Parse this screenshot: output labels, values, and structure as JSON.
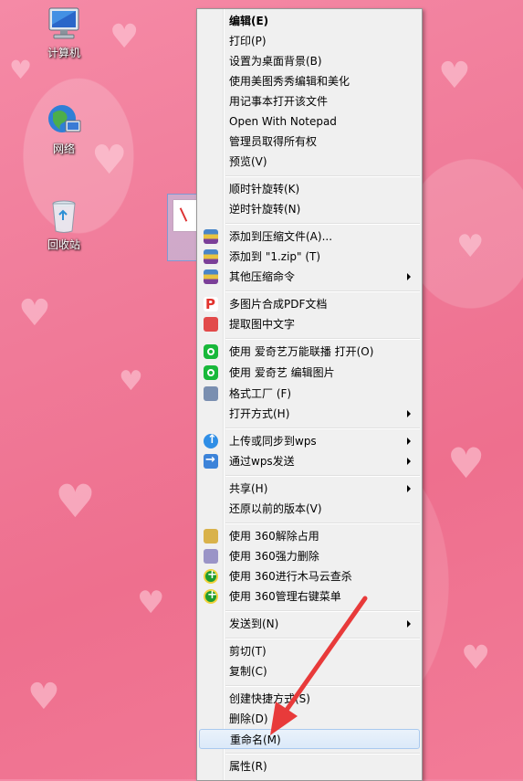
{
  "desktop": {
    "icons": [
      {
        "label": "计算机",
        "icon": "computer-icon"
      },
      {
        "label": "网络",
        "icon": "network-icon"
      },
      {
        "label": "回收站",
        "icon": "recycle-bin-icon"
      }
    ]
  },
  "context_menu": {
    "items": [
      {
        "label": "编辑(E)",
        "bold": true
      },
      {
        "label": "打印(P)"
      },
      {
        "label": "设置为桌面背景(B)"
      },
      {
        "label": "使用美图秀秀编辑和美化"
      },
      {
        "label": "用记事本打开该文件"
      },
      {
        "label": "Open With Notepad"
      },
      {
        "label": "管理员取得所有权"
      },
      {
        "label": "预览(V)"
      },
      {
        "label": "顺时针旋转(K)"
      },
      {
        "label": "逆时针旋转(N)"
      },
      {
        "label": "添加到压缩文件(A)...",
        "icon": "winrar-icon"
      },
      {
        "label": "添加到 \"1.zip\" (T)",
        "icon": "winrar-icon"
      },
      {
        "label": "其他压缩命令",
        "icon": "winrar-icon",
        "submenu": true
      },
      {
        "label": "多图片合成PDF文档",
        "icon": "pdf-icon"
      },
      {
        "label": "提取图中文字",
        "icon": "extract-text-icon"
      },
      {
        "label": "使用 爱奇艺万能联播 打开(O)",
        "icon": "iqiyi-icon"
      },
      {
        "label": "使用 爱奇艺 编辑图片",
        "icon": "iqiyi-icon"
      },
      {
        "label": "格式工厂 (F)",
        "icon": "format-factory-icon"
      },
      {
        "label": "打开方式(H)",
        "submenu": true
      },
      {
        "label": "上传或同步到wps",
        "icon": "cloud-upload-icon",
        "submenu": true
      },
      {
        "label": "通过wps发送",
        "icon": "send-icon",
        "submenu": true
      },
      {
        "label": "共享(H)",
        "submenu": true
      },
      {
        "label": "还原以前的版本(V)"
      },
      {
        "label": "使用 360解除占用",
        "icon": "unlock-icon"
      },
      {
        "label": "使用 360强力删除",
        "icon": "shredder-icon"
      },
      {
        "label": "使用 360进行木马云查杀",
        "icon": "360-icon"
      },
      {
        "label": "使用 360管理右键菜单",
        "icon": "360-icon"
      },
      {
        "label": "发送到(N)",
        "submenu": true
      },
      {
        "label": "剪切(T)"
      },
      {
        "label": "复制(C)"
      },
      {
        "label": "创建快捷方式(S)"
      },
      {
        "label": "删除(D)"
      },
      {
        "label": "重命名(M)",
        "highlighted": true
      },
      {
        "label": "属性(R)"
      }
    ]
  },
  "annotation": {
    "arrow_color": "#e83a3a"
  }
}
